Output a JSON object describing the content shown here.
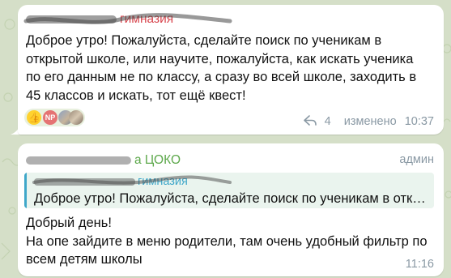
{
  "colors": {
    "wallpaper": "#d5dfc8",
    "bubble": "#ffffff",
    "sender1": "#d8474f",
    "sender2": "#5da84b",
    "reply_accent": "#3fa7c9",
    "meta": "#8a99a4"
  },
  "message1": {
    "sender": "гимназия",
    "sender_suffix": "",
    "lines": [
      "Доброе утро! Пожалуйста, сделайте поиск по ученикам в",
      "открытой школе, или научите, пожалуйста, как искать ученика",
      "по его данным не по классу, а сразу во всей школе, заходить в",
      "45 классов и искать, тот ещё квест!"
    ],
    "reactions": {
      "emoji": "👍",
      "avatar_initials": "NP",
      "icon": "thumbs-up-icon"
    },
    "forwards": "4",
    "edited_label": "изменено",
    "time": "10:37"
  },
  "message2": {
    "sender": "а ЦОКО",
    "role": "админ",
    "reply": {
      "author": "гимназия",
      "text": "Доброе утро! Пожалуйста, сделайте поиск по ученикам в отк…"
    },
    "lines": [
      "Добрый день!",
      "На опе зайдите в меню родители, там очень удобный фильтр по",
      "всем детям школы"
    ],
    "time": "11:16"
  }
}
